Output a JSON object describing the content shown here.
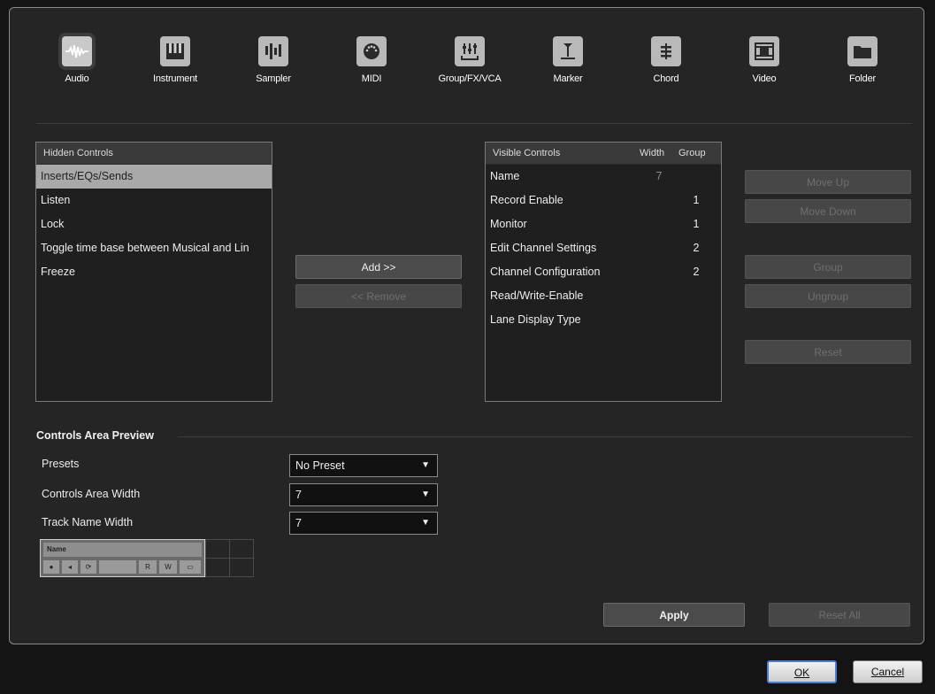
{
  "track_types": [
    {
      "label": "Audio",
      "icon": "waveform-icon",
      "active": true
    },
    {
      "label": "Instrument",
      "icon": "piano-keys-icon",
      "active": false
    },
    {
      "label": "Sampler",
      "icon": "sampler-bars-icon",
      "active": false
    },
    {
      "label": "MIDI",
      "icon": "midi-connector-icon",
      "active": false
    },
    {
      "label": "Group/FX/VCA",
      "icon": "fader-group-icon",
      "active": false
    },
    {
      "label": "Marker",
      "icon": "marker-icon",
      "active": false
    },
    {
      "label": "Chord",
      "icon": "chord-icon",
      "active": false
    },
    {
      "label": "Video",
      "icon": "film-icon",
      "active": false
    },
    {
      "label": "Folder",
      "icon": "folder-icon",
      "active": false
    }
  ],
  "hidden_controls": {
    "header": "Hidden Controls",
    "items": [
      "Inserts/EQs/Sends",
      "Listen",
      "Lock",
      "Toggle time base between Musical and Lin",
      "Freeze"
    ],
    "selected_index": 0
  },
  "visible_controls": {
    "header": "Visible Controls",
    "width_header": "Width",
    "group_header": "Group",
    "rows": [
      {
        "name": "Name",
        "width": "7",
        "group": ""
      },
      {
        "name": "Record Enable",
        "width": "",
        "group": "1"
      },
      {
        "name": "Monitor",
        "width": "",
        "group": "1"
      },
      {
        "name": "Edit Channel Settings",
        "width": "",
        "group": "2"
      },
      {
        "name": "Channel Configuration",
        "width": "",
        "group": "2"
      },
      {
        "name": "Read/Write-Enable",
        "width": "",
        "group": ""
      },
      {
        "name": "Lane Display Type",
        "width": "",
        "group": ""
      }
    ]
  },
  "buttons": {
    "add": "Add >>",
    "remove": "<< Remove",
    "move_up": "Move Up",
    "move_down": "Move Down",
    "group": "Group",
    "ungroup": "Ungroup",
    "reset": "Reset",
    "apply": "Apply",
    "reset_all": "Reset All",
    "ok": "OK",
    "cancel": "Cancel"
  },
  "preview": {
    "section_title": "Controls Area Preview",
    "presets_label": "Presets",
    "presets_value": "No Preset",
    "controls_width_label": "Controls Area Width",
    "controls_width_value": "7",
    "track_name_width_label": "Track Name Width",
    "track_name_width_value": "7",
    "mini_name": "Name",
    "mini_controls": [
      "●",
      "◂",
      "⟳",
      "",
      "R",
      "W",
      "▭"
    ]
  }
}
